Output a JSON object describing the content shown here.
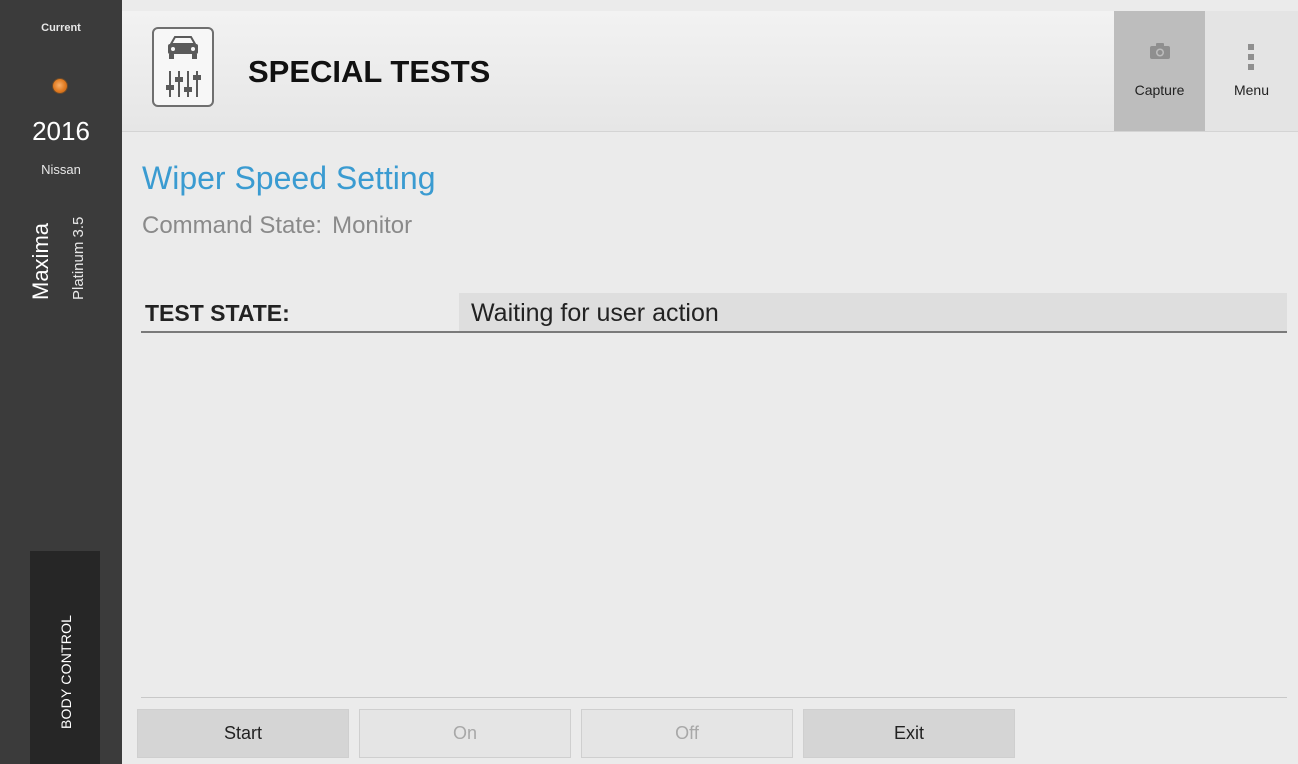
{
  "sidebar": {
    "current_label": "Current",
    "year": "2016",
    "make": "Nissan",
    "model": "Maxima",
    "trim": "Platinum 3.5",
    "system_tab": "BODY CONTROL",
    "status_color": "#e07a20"
  },
  "header": {
    "title": "SPECIAL TESTS",
    "icon": "car-sliders-icon",
    "capture_label": "Capture",
    "menu_label": "Menu"
  },
  "main": {
    "feature_title": "Wiper Speed Setting",
    "command_state_label": "Command State:",
    "command_state_value": "Monitor",
    "test_state_label": "TEST STATE:",
    "test_state_value": "Waiting for user action"
  },
  "footer": {
    "buttons": [
      {
        "label": "Start",
        "enabled": true
      },
      {
        "label": "On",
        "enabled": false
      },
      {
        "label": "Off",
        "enabled": false
      },
      {
        "label": "Exit",
        "enabled": true
      }
    ]
  },
  "colors": {
    "accent": "#3a9bd1",
    "sidebar_bg": "#3b3b3b"
  }
}
